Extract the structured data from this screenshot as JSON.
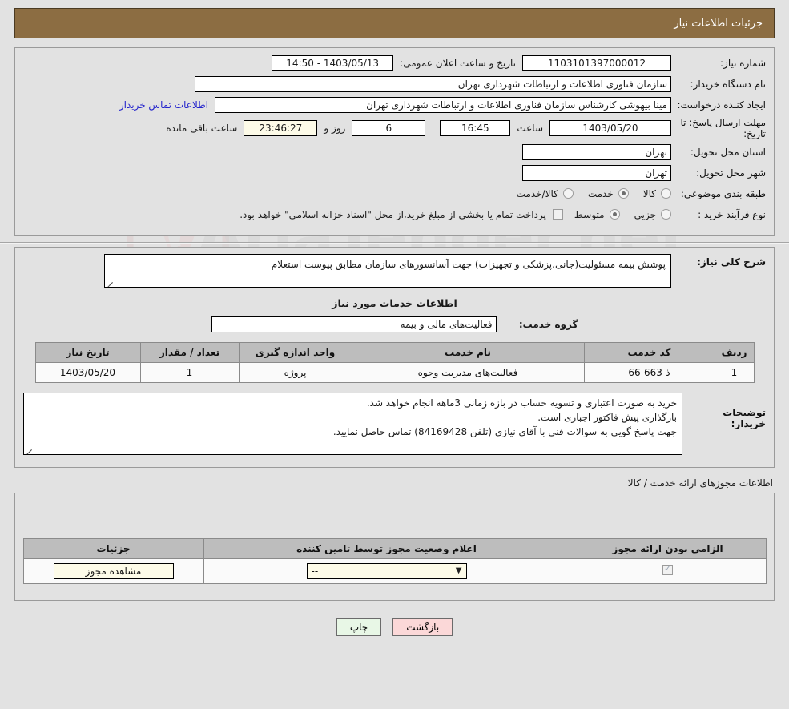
{
  "header": {
    "title": "جزئیات اطلاعات نیاز"
  },
  "watermark": {
    "text": "AriaTender.net"
  },
  "form": {
    "need_number_label": "شماره نیاز:",
    "need_number_value": "1103101397000012",
    "public_announce_label": "تاریخ و ساعت اعلان عمومی:",
    "public_announce_value": "1403/05/13 - 14:50",
    "buyer_org_label": "نام دستگاه خریدار:",
    "buyer_org_value": "سازمان فناوری اطلاعات و ارتباطات شهرداری تهران",
    "requester_label": "ایجاد کننده درخواست:",
    "requester_value": "مینا بیهوشی کارشناس سازمان فناوری اطلاعات و ارتباطات شهرداری تهران",
    "buyer_contact_link": "اطلاعات تماس خریدار",
    "deadline_label": "مهلت ارسال پاسخ: تا تاریخ:",
    "deadline_date": "1403/05/20",
    "deadline_hour_label": "ساعت",
    "deadline_time": "16:45",
    "remaining_days": "6",
    "remaining_days_label": "روز و",
    "remaining_clock": "23:46:27",
    "remaining_clock_label": "ساعت باقی مانده",
    "province_label": "استان محل تحویل:",
    "province_value": "تهران",
    "city_label": "شهر محل تحویل:",
    "city_value": "تهران",
    "category_label": "طبقه بندی موضوعی:",
    "category_options": [
      {
        "label": "کالا",
        "selected": false
      },
      {
        "label": "خدمت",
        "selected": true
      },
      {
        "label": "کالا/خدمت",
        "selected": false
      }
    ],
    "process_label": "نوع فرآیند خرید :",
    "process_options": [
      {
        "label": "جزیی",
        "selected": false
      },
      {
        "label": "متوسط",
        "selected": true
      }
    ],
    "treasury_checkbox_checked": false,
    "treasury_note": "پرداخت تمام یا بخشی از مبلغ خرید،از محل \"اسناد خزانه اسلامی\" خواهد بود."
  },
  "summary": {
    "label": "شرح کلی نیاز:",
    "value": "پوشش بیمه مسئولیت(جانی،پزشکی و تجهیزات) جهت آسانسورهای سازمان مطابق پیوست استعلام"
  },
  "services": {
    "section_title": "اطلاعات خدمات مورد نیاز",
    "group_label": "گروه خدمت:",
    "group_value": "فعالیت‌های مالی و بیمه",
    "columns": [
      "ردیف",
      "کد خدمت",
      "نام خدمت",
      "واحد اندازه گیری",
      "تعداد / مقدار",
      "تاریخ نیاز"
    ],
    "rows": [
      {
        "index": "1",
        "code": "ذ-663-66",
        "name": "فعالیت‌های مدیریت وجوه",
        "unit": "پروژه",
        "quantity": "1",
        "need_date": "1403/05/20"
      }
    ]
  },
  "buyer_notes": {
    "label": "توضیحات خریدار:",
    "lines": [
      "خرید به صورت اعتباری و تسویه حساب در بازه زمانی 3ماهه انجام خواهد شد.",
      "بارگذاری پیش فاکتور اجباری است.",
      "جهت پاسخ گویی به سوالات فنی با آقای نیازی (تلفن 84169428) تماس حاصل نمایید."
    ]
  },
  "permits": {
    "section_title": "اطلاعات مجوزهای ارائه خدمت / کالا",
    "columns": [
      "الزامی بودن ارائه مجوز",
      "اعلام وضعیت مجوز توسط تامین کننده",
      "جزئیات"
    ],
    "rows": [
      {
        "required_checked": true,
        "status_value": "--",
        "details_button": "مشاهده مجوز"
      }
    ]
  },
  "footer": {
    "print_label": "چاپ",
    "back_label": "بازگشت"
  }
}
